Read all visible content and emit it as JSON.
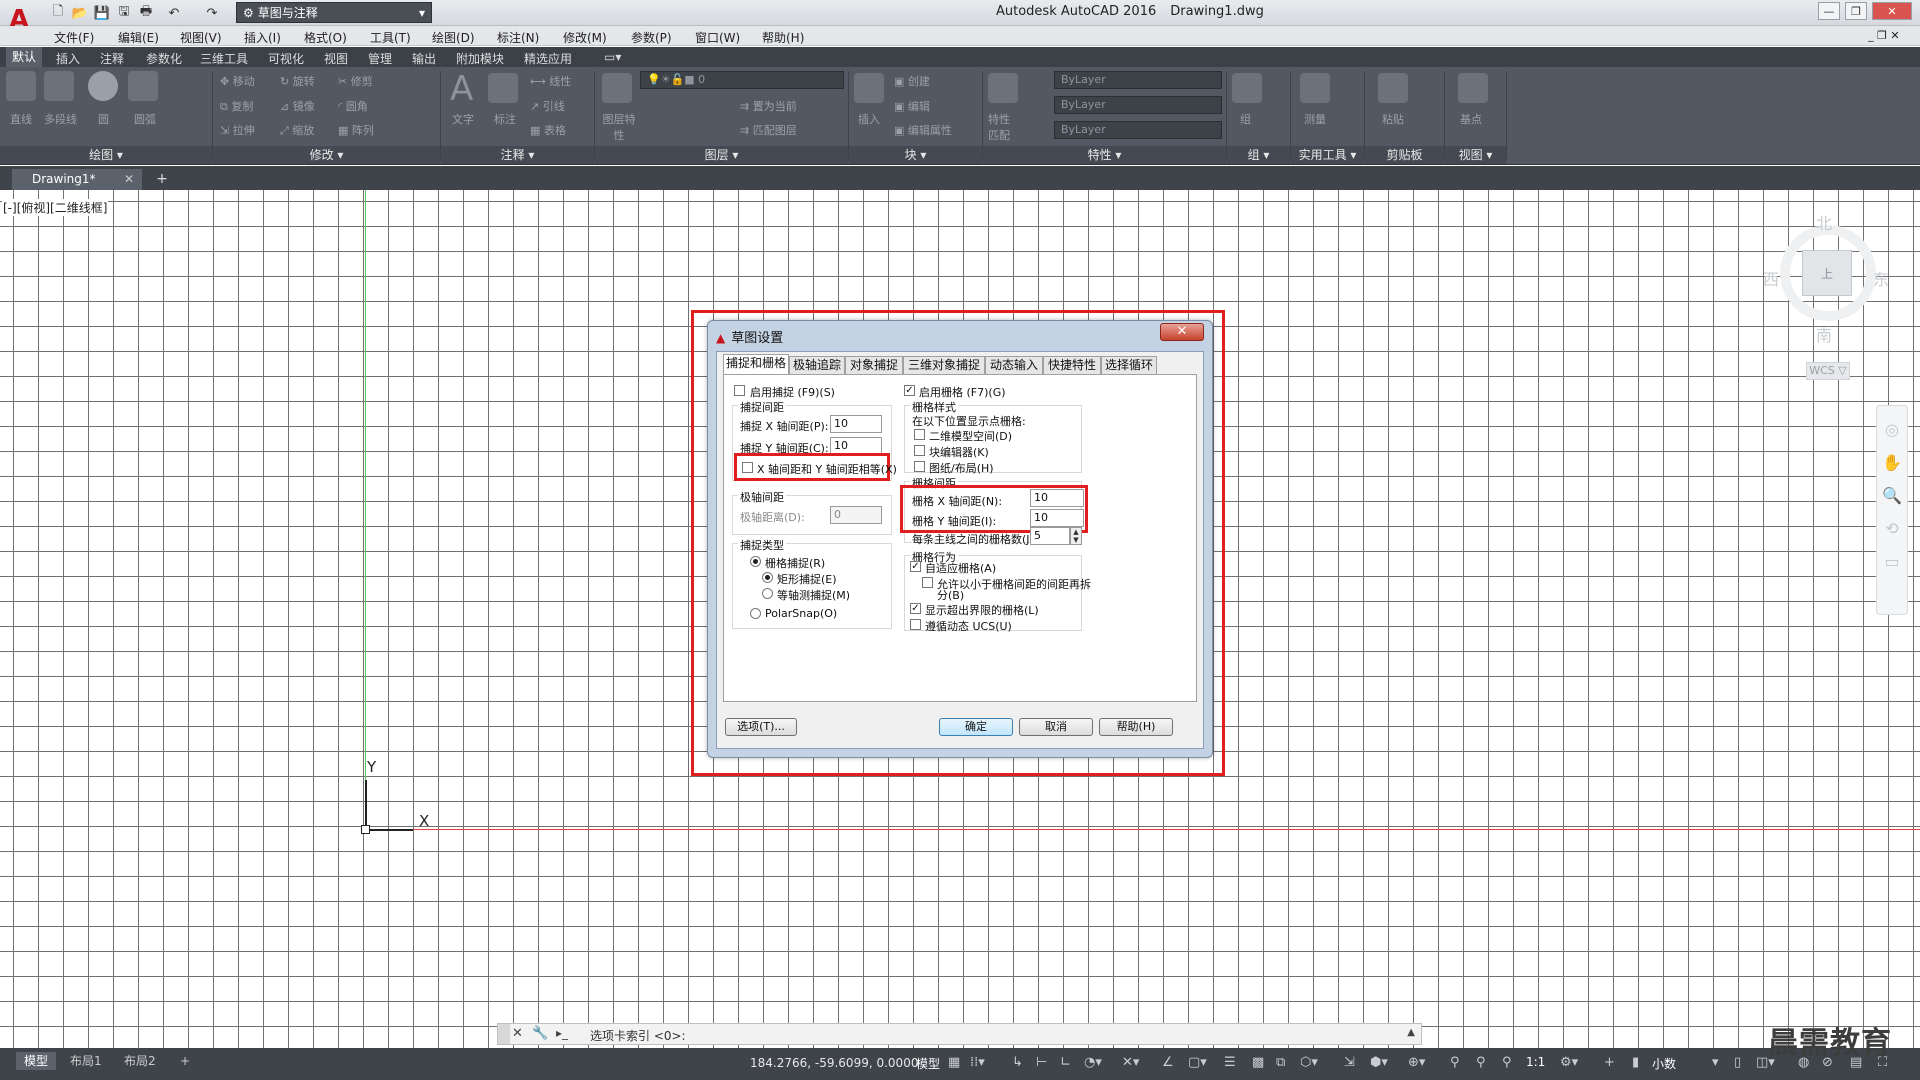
{
  "app": {
    "title": "Autodesk AutoCAD 2016",
    "filename": "Drawing1.dwg",
    "workspace": "草图与注释"
  },
  "menubar": [
    "文件(F)",
    "编辑(E)",
    "视图(V)",
    "插入(I)",
    "格式(O)",
    "工具(T)",
    "绘图(D)",
    "标注(N)",
    "修改(M)",
    "参数(P)",
    "窗口(W)",
    "帮助(H)"
  ],
  "ribbon_tabs": [
    "默认",
    "插入",
    "注释",
    "参数化",
    "三维工具",
    "可视化",
    "视图",
    "管理",
    "输出",
    "附加模块",
    "精选应用"
  ],
  "ribbon": {
    "draw_tools": [
      "直线",
      "多段线",
      "圆",
      "圆弧"
    ],
    "modify_tools": [
      "移动",
      "旋转",
      "修剪",
      "复制",
      "镜像",
      "圆角",
      "拉伸",
      "缩放",
      "阵列"
    ],
    "annotation_tools": [
      "文字",
      "标注",
      "线性",
      "引线",
      "表格"
    ],
    "layer_tools": [
      "图层特性",
      "置为当前",
      "匹配图层"
    ],
    "layer_value": "0",
    "block_tools": [
      "插入",
      "创建",
      "编辑",
      "编辑属性"
    ],
    "prop_tools": [
      "特性匹配"
    ],
    "props": [
      "ByLayer",
      "ByLayer",
      "ByLayer"
    ],
    "groups_tools": [
      "组"
    ],
    "util_tools": [
      "测量"
    ],
    "clip_tools": [
      "粘贴"
    ],
    "view_tools": [
      "基点"
    ],
    "panels": [
      "绘图 ▾",
      "修改 ▾",
      "注释 ▾",
      "图层 ▾",
      "块 ▾",
      "特性 ▾",
      "组 ▾",
      "实用工具 ▾",
      "剪贴板",
      "视图 ▾"
    ]
  },
  "doc_tab": "Drawing1*",
  "viewport_label": "[-][俯视][二维线框]",
  "viewcube": {
    "n": "北",
    "s": "南",
    "w": "西",
    "e": "东",
    "center": "上",
    "wcs": "WCS ▽"
  },
  "ucs": {
    "x": "X",
    "y": "Y"
  },
  "dialog": {
    "title": "草图设置",
    "tabs": [
      "捕捉和栅格",
      "极轴追踪",
      "对象捕捉",
      "三维对象捕捉",
      "动态输入",
      "快捷特性",
      "选择循环"
    ],
    "snap_on": "启用捕捉 (F9)(S)",
    "snap_spacing": "捕捉间距",
    "snap_x_label": "捕捉 X 轴间距(P):",
    "snap_x": "10",
    "snap_y_label": "捕捉 Y 轴间距(C):",
    "snap_y": "10",
    "equal_xy": "X 轴间距和 Y 轴间距相等(X)",
    "polar_spacing": "极轴间距",
    "polar_distance_label": "极轴距离(D):",
    "polar_distance": "0",
    "snap_type": "捕捉类型",
    "grid_snap": "栅格捕捉(R)",
    "rect_snap": "矩形捕捉(E)",
    "iso_snap": "等轴测捕捉(M)",
    "polarsnap": "PolarSnap(O)",
    "grid_on": "启用栅格 (F7)(G)",
    "grid_style": "栅格样式",
    "grid_style_desc": "在以下位置显示点栅格:",
    "model_space": "二维模型空间(D)",
    "block_editor": "块编辑器(K)",
    "sheet_layout": "图纸/布局(H)",
    "grid_spacing": "栅格间距",
    "grid_x_label": "栅格 X 轴间距(N):",
    "grid_x": "10",
    "grid_y_label": "栅格 Y 轴间距(I):",
    "grid_y": "10",
    "major_label": "每条主线之间的栅格数(J):",
    "major": "5",
    "grid_behavior": "栅格行为",
    "adaptive": "自适应栅格(A)",
    "subdivide": "允许以小于栅格间距的间距再拆",
    "subdivide2": "分(B)",
    "beyond_limits": "显示超出界限的栅格(L)",
    "follow_ucs": "遵循动态 UCS(U)",
    "options_btn": "选项(T)...",
    "ok_btn": "确定",
    "cancel_btn": "取消",
    "help_btn": "帮助(H)"
  },
  "command_line": {
    "text": "选项卡索引 <0>:"
  },
  "layout_tabs": [
    "模型",
    "布局1",
    "布局2"
  ],
  "status": {
    "coords": "184.2766, -59.6099, 0.0000",
    "space": "模型",
    "scale": "1:1",
    "units": "小数"
  },
  "watermark": "晨需教育"
}
